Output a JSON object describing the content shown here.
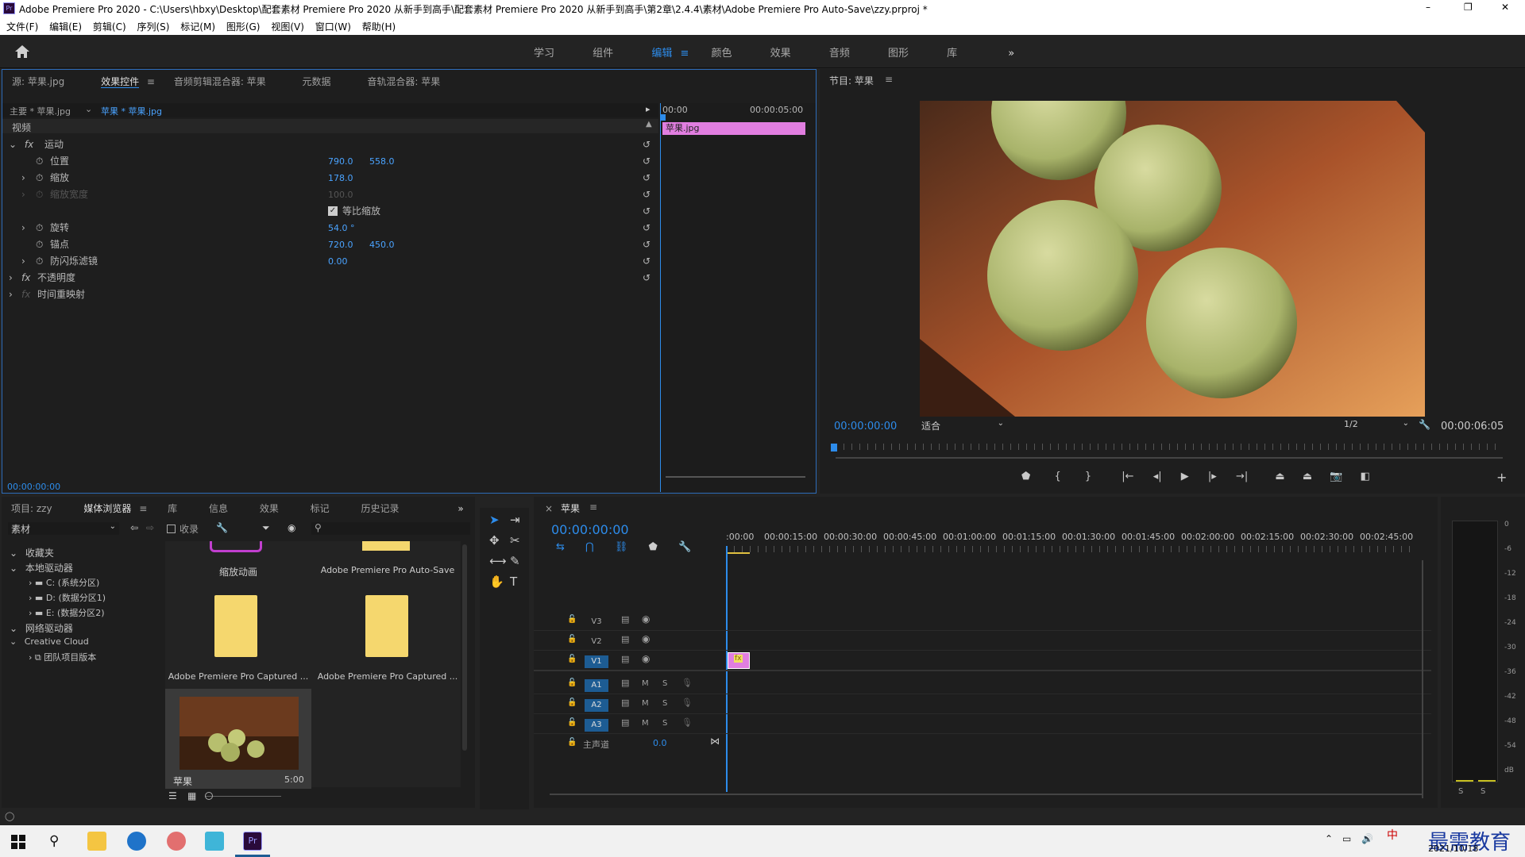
{
  "title_bar": {
    "app_title": "Adobe Premiere Pro 2020 - C:\\Users\\hbxy\\Desktop\\配套素材 Premiere Pro 2020 从新手到高手\\配套素材 Premiere Pro 2020 从新手到高手\\第2章\\2.4.4\\素材\\Adobe Premiere Pro Auto-Save\\zzy.prproj *",
    "minimize": "–",
    "maximize": "❐",
    "close": "✕"
  },
  "menu": [
    "文件(F)",
    "编辑(E)",
    "剪辑(C)",
    "序列(S)",
    "标记(M)",
    "图形(G)",
    "视图(V)",
    "窗口(W)",
    "帮助(H)"
  ],
  "workspaces": {
    "items": [
      "学习",
      "组件",
      "编辑",
      "颜色",
      "效果",
      "音频",
      "图形",
      "库"
    ],
    "active": "编辑",
    "more": "»"
  },
  "effect_panel": {
    "tabs": [
      "源: 苹果.jpg",
      "效果控件",
      "音频剪辑混合器: 苹果",
      "元数据",
      "音轨混合器: 苹果"
    ],
    "master_clip": "主要 * 苹果.jpg",
    "seq_clip": "苹果 * 苹果.jpg",
    "timeline_start": "00:00",
    "timeline_end": "00:00:05:00",
    "clip_label": "苹果.jpg",
    "section_video": "视频",
    "motion": "运动",
    "position_label": "位置",
    "position_x": "790.0",
    "position_y": "558.0",
    "scale_label": "缩放",
    "scale_value": "178.0",
    "scale_width_label": "缩放宽度",
    "scale_width_value": "100.0",
    "uniform_scale": "等比缩放",
    "rotation_label": "旋转",
    "rotation_value": "54.0 °",
    "anchor_label": "锚点",
    "anchor_x": "720.0",
    "anchor_y": "450.0",
    "flicker_label": "防闪烁滤镜",
    "flicker_value": "0.00",
    "opacity": "不透明度",
    "time_remap": "时间重映射",
    "current_time": "00:00:00:00"
  },
  "program_monitor": {
    "title": "节目: 苹果",
    "timecode": "00:00:00:00",
    "fit": "适合",
    "resolution": "1/2",
    "duration": "00:00:06:05"
  },
  "project_panel": {
    "tabs": [
      "项目: zzy",
      "媒体浏览器",
      "库",
      "信息",
      "效果",
      "标记",
      "历史记录"
    ],
    "active_tab": "媒体浏览器",
    "filter_select": "素材",
    "ingest": "收录",
    "tree": [
      "收藏夹",
      "本地驱动器",
      "C: (系统分区)",
      "D: (数据分区1)",
      "E: (数据分区2)",
      "网络驱动器",
      "Creative Cloud",
      "团队项目版本"
    ],
    "tiles": [
      {
        "name": "缩放动画"
      },
      {
        "name": "Adobe Premiere Pro Auto-Save"
      },
      {
        "name": "Adobe Premiere Pro Captured ..."
      },
      {
        "name": "Adobe Premiere Pro Captured ..."
      },
      {
        "name": "苹果",
        "duration": "5:00"
      }
    ]
  },
  "timeline": {
    "title": "苹果",
    "timecode": "00:00:00:00",
    "ruler": [
      ":00:00",
      "00:00:15:00",
      "00:00:30:00",
      "00:00:45:00",
      "00:01:00:00",
      "00:01:15:00",
      "00:01:30:00",
      "00:01:45:00",
      "00:02:00:00",
      "00:02:15:00",
      "00:02:30:00",
      "00:02:45:00"
    ],
    "video_tracks": [
      "V3",
      "V2",
      "V1"
    ],
    "audio_tracks": [
      "A1",
      "A2",
      "A3"
    ],
    "master": "主声道",
    "master_value": "0.0",
    "clip_badge": "fx",
    "mute": "M",
    "solo": "S"
  },
  "audio_meter": {
    "scale": [
      "0",
      "-6",
      "-12",
      "-18",
      "-24",
      "-30",
      "-36",
      "-42",
      "-48",
      "-54",
      "dB"
    ],
    "solo_left": "S",
    "solo_right": "S"
  },
  "taskbar": {
    "time": "",
    "date": "2021/10/18",
    "ime": "中",
    "watermark": "最需教育"
  },
  "colors": {
    "accent": "#2d8ceb",
    "clip_pink": "#e17ee0",
    "panel_focus": "#2d6bb8"
  }
}
